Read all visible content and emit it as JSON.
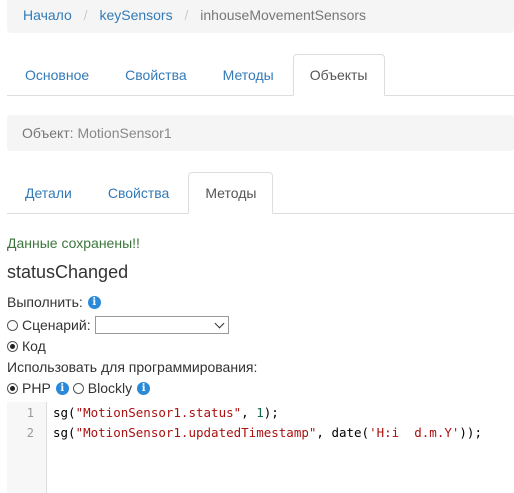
{
  "breadcrumb": {
    "home": "Начало",
    "class": "keySensors",
    "current": "inhouseMovementSensors"
  },
  "main_tabs": [
    "Основное",
    "Свойства",
    "Методы",
    "Объекты"
  ],
  "main_tabs_active": "Объекты",
  "object_panel": {
    "label": "Объект:",
    "name": "MotionSensor1"
  },
  "sub_tabs": [
    "Детали",
    "Свойства",
    "Методы"
  ],
  "sub_tabs_active": "Методы",
  "saved_message": "Данные сохранены!!",
  "method_name": "statusChanged",
  "form": {
    "execute_label": "Выполнить:",
    "scenario_label": "Сценарий:",
    "scenario_value": "",
    "code_label": "Код",
    "selected_mode": "Код",
    "lang_label": "Использовать для программирования:",
    "lang_php": "PHP",
    "lang_blockly": "Blockly",
    "selected_lang": "PHP"
  },
  "code": {
    "lines": [
      {
        "num": "1",
        "prefix": "sg(",
        "str1": "\"MotionSensor1.status\"",
        "mid": ", ",
        "num_lit": "1",
        "str2": "",
        "suffix": ");"
      },
      {
        "num": "2",
        "prefix": "sg(",
        "str1": "\"MotionSensor1.updatedTimestamp\"",
        "mid": ", date(",
        "num_lit": "",
        "str2": "'H:i  d.m.Y'",
        "suffix": "));"
      }
    ]
  },
  "colors": {
    "link": "#337ab7",
    "success": "#3c763d",
    "info_icon": "#2b8ad8"
  }
}
